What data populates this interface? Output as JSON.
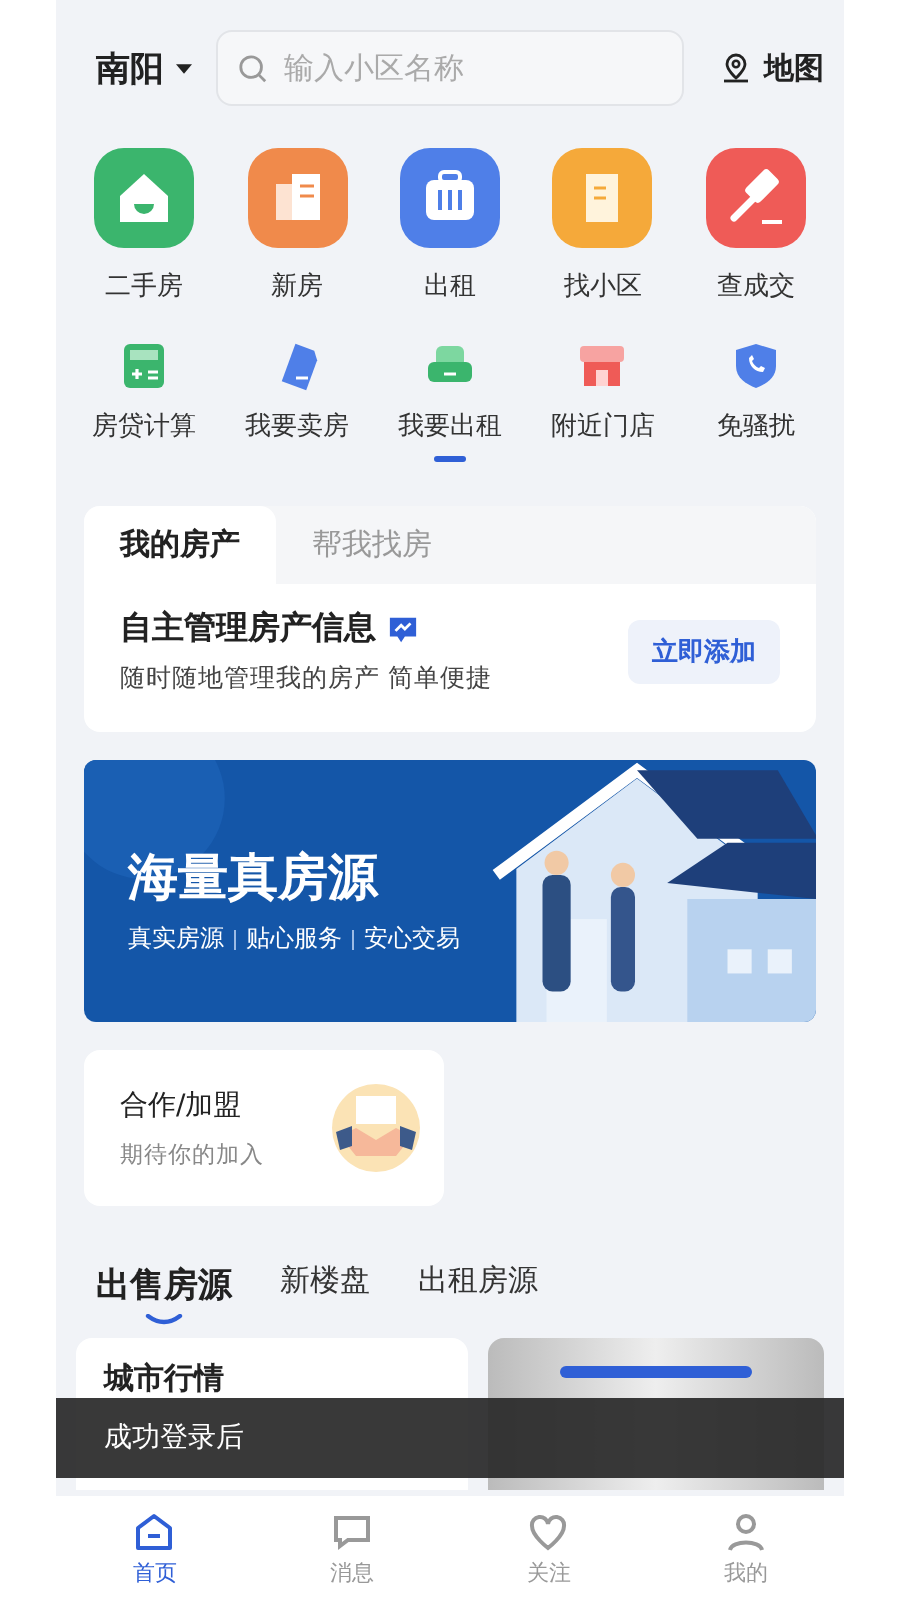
{
  "header": {
    "city": "南阳",
    "search": {
      "placeholder": "输入小区名称"
    },
    "map": "地图"
  },
  "main_entries": [
    {
      "label": "二手房",
      "kind": "house",
      "color": "#3bb56d"
    },
    {
      "label": "新房",
      "kind": "building",
      "color": "#f08a4b"
    },
    {
      "label": "出租",
      "kind": "suitcase",
      "color": "#4f7fe8"
    },
    {
      "label": "找小区",
      "kind": "tower",
      "color": "#f5a93a"
    },
    {
      "label": "查成交",
      "kind": "gavel",
      "color": "#ef5b57"
    }
  ],
  "tools": [
    {
      "label": "房贷计算",
      "kind": "calculator",
      "selected": false
    },
    {
      "label": "我要卖房",
      "kind": "tag",
      "selected": false
    },
    {
      "label": "我要出租",
      "kind": "sofa",
      "selected": true
    },
    {
      "label": "附近门店",
      "kind": "store",
      "selected": false
    },
    {
      "label": "免骚扰",
      "kind": "shield",
      "selected": false
    }
  ],
  "property_card": {
    "tabs": [
      {
        "label": "我的房产",
        "selected": true
      },
      {
        "label": "帮我找房",
        "selected": false
      }
    ],
    "title": "自主管理房产信息",
    "subtitle": "随时随地管理我的房产 简单便捷",
    "button": "立即添加"
  },
  "banner": {
    "title": "海量真房源",
    "tags": [
      "真实房源",
      "贴心服务",
      "安心交易"
    ]
  },
  "join_card": {
    "title": "合作/加盟",
    "subtitle": "期待你的加入"
  },
  "feed_tabs": [
    {
      "label": "出售房源",
      "selected": true
    },
    {
      "label": "新楼盘",
      "selected": false
    },
    {
      "label": "出租房源",
      "selected": false
    }
  ],
  "feed_cards": [
    {
      "title": "城市行情"
    }
  ],
  "toast": "成功登录后",
  "bottom_nav": [
    {
      "label": "首页",
      "kind": "home",
      "selected": true
    },
    {
      "label": "消息",
      "kind": "chat",
      "selected": false
    },
    {
      "label": "关注",
      "kind": "heart",
      "selected": false
    },
    {
      "label": "我的",
      "kind": "user",
      "selected": false
    }
  ]
}
